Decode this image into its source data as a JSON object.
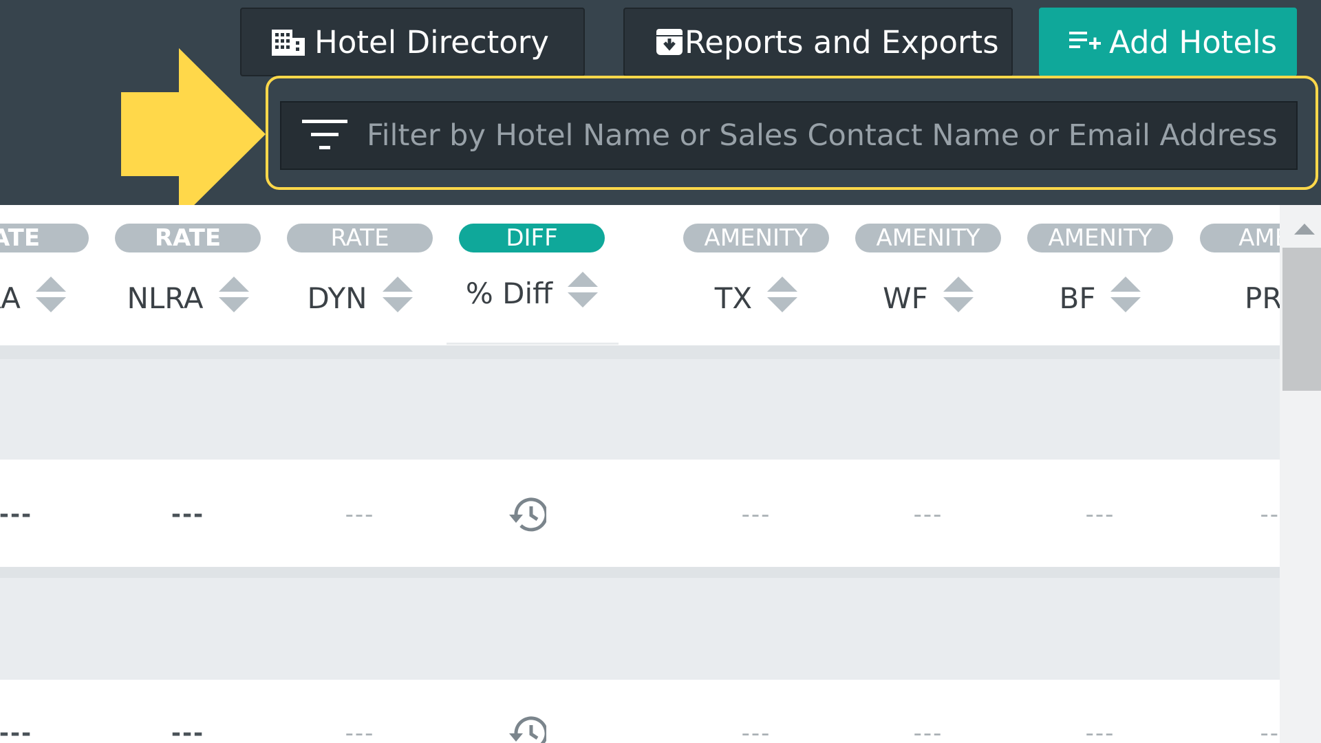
{
  "toolbar": {
    "hotel_directory_label": "Hotel Directory",
    "reports_label": "Reports and Exports",
    "add_hotels_label": "Add Hotels"
  },
  "search": {
    "placeholder": "Filter by Hotel Name or Sales Contact Name or Email Address"
  },
  "columns": [
    {
      "category": "ATE",
      "label": "LRA"
    },
    {
      "category": "RATE",
      "label": "NLRA"
    },
    {
      "category": "RATE",
      "label": "DYN"
    },
    {
      "category": "DIFF",
      "label": "% Diff"
    },
    {
      "category": "AMENITY",
      "label": "TX"
    },
    {
      "category": "AMENITY",
      "label": "WF"
    },
    {
      "category": "AMENITY",
      "label": "BF"
    },
    {
      "category": "AMEN",
      "label": "PR"
    }
  ],
  "rows": [
    {
      "cells": [
        "---",
        "---",
        "---",
        "",
        "---",
        "---",
        "---",
        "--"
      ]
    },
    {
      "cells": [
        "---",
        "---",
        "---",
        "",
        "---",
        "---",
        "---",
        "--"
      ]
    }
  ],
  "icons": {
    "hotel_directory": "building-icon",
    "reports": "archive-download-icon",
    "add_hotels": "playlist-add-icon",
    "filter": "filter-icon",
    "history": "history-icon",
    "sort": "sort-arrows-icon",
    "annotation": "yellow-arrow-icon"
  },
  "colors": {
    "topbar": "#37444d",
    "accent": "#0fa89a",
    "highlight": "#ffd84a",
    "pill": "#b5bec4"
  }
}
